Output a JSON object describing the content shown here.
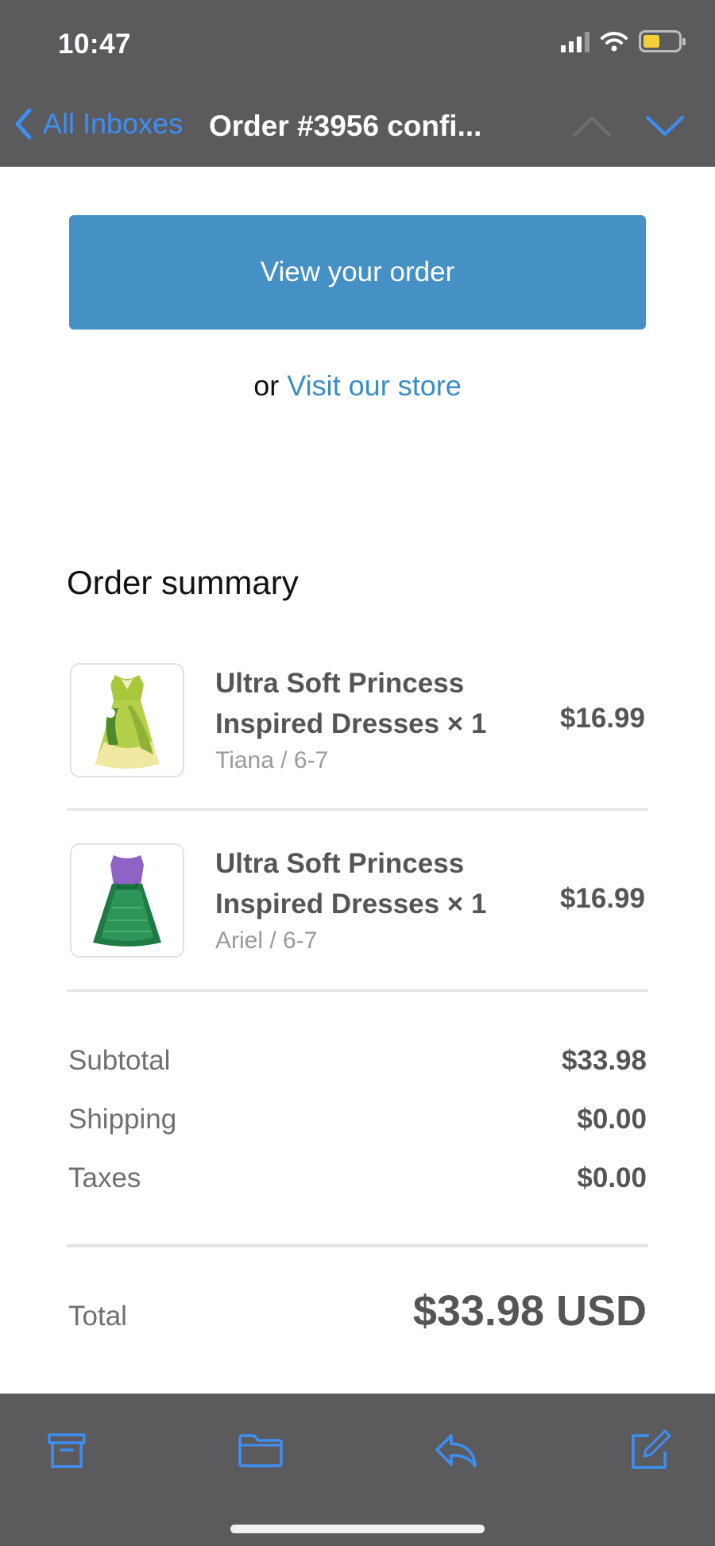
{
  "status_bar": {
    "time": "10:47",
    "battery_color": "#f2d039"
  },
  "nav": {
    "back_label": "All Inboxes",
    "title": "Order #3956 confi...",
    "accent": "#3d8ff5"
  },
  "email": {
    "view_order_button": "View your order",
    "visit_prefix": "or",
    "visit_link": "Visit our store",
    "summary_title": "Order summary",
    "items": [
      {
        "name": "Ultra Soft Princess Inspired Dresses × 1",
        "variant": "Tiana / 6-7",
        "price": "$16.99",
        "image": "green-princess-dress"
      },
      {
        "name": "Ultra Soft Princess Inspired Dresses × 1",
        "variant": "Ariel / 6-7",
        "price": "$16.99",
        "image": "mermaid-dress"
      }
    ],
    "totals": {
      "subtotal_label": "Subtotal",
      "subtotal": "$33.98",
      "shipping_label": "Shipping",
      "shipping": "$0.00",
      "taxes_label": "Taxes",
      "taxes": "$0.00",
      "total_label": "Total",
      "total": "$33.98 USD"
    },
    "button_color": "#4590c4",
    "link_color": "#3a8ec6"
  },
  "toolbar": {
    "icons": [
      "archive-icon",
      "folder-icon",
      "reply-icon",
      "compose-icon"
    ]
  }
}
